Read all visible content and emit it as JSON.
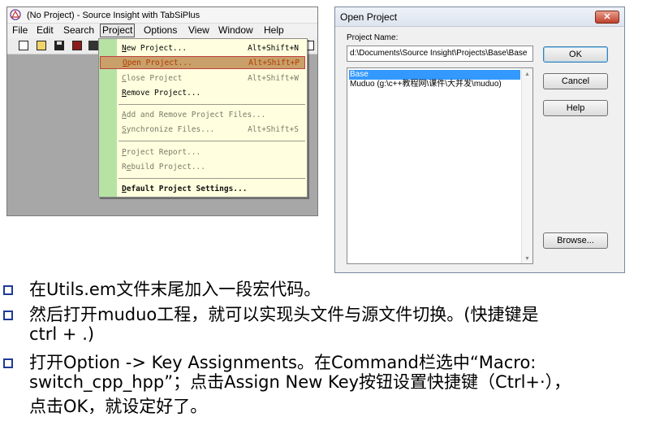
{
  "si_window": {
    "title": "(No Project) - Source Insight with TabSiPlus",
    "menu": [
      "File",
      "Edit",
      "Search",
      "Project",
      "Options",
      "View",
      "Window",
      "Help"
    ],
    "active_menu": "Project",
    "project_menu": {
      "new_hotkey": "N",
      "new_rest": "ew Project...",
      "new_shortcut": "Alt+Shift+N",
      "open_hotkey": "O",
      "open_rest": "pen Project...",
      "open_shortcut": "Alt+Shift+P",
      "close_hotkey": "C",
      "close_rest": "lose Project",
      "close_shortcut": "Alt+Shift+W",
      "remove_hotkey": "R",
      "remove_rest": "emove Project...",
      "add_hotkey": "A",
      "add_rest": "dd and Remove Project Files...",
      "sync_hotkey": "S",
      "sync_rest": "ynchronize Files...",
      "sync_shortcut": "Alt+Shift+S",
      "report_hotkey": "P",
      "report_rest": "roject Report...",
      "rebuild_a": "R",
      "rebuild_hotkey": "e",
      "rebuild_rest": "build Project...",
      "default_hotkey": "D",
      "default_rest": "efault Project Settings..."
    }
  },
  "dialog": {
    "title": "Open Project",
    "close_glyph": "✕",
    "name_label": "Project Name:",
    "name_value": "d:\\Documents\\Source Insight\\Projects\\Base\\Base",
    "list_items": [
      "Base",
      "Muduo (g:\\c++教程网\\课件\\大并发\\muduo)"
    ],
    "selected_index": 0,
    "buttons": {
      "ok": "OK",
      "cancel": "Cancel",
      "help": "Help",
      "browse": "Browse..."
    }
  },
  "bullets": [
    [
      "在Utils.em文件末尾加入一段宏代码。"
    ],
    [
      "然后打开muduo工程，就可以实现头文件与源文件切换。(快捷键是",
      "ctrl + .)"
    ],
    [
      "打开Option -> Key Assignments。在Command栏选中“Macro:",
      "switch_cpp_hpp”；点击Assign New Key按钮设置快捷键（Ctrl+·），",
      "点击OK，就设定好了。"
    ]
  ],
  "colors": {
    "bullet_box": "#1f3a93",
    "menu_gutter": "#b6e3a4",
    "menu_bg": "#ffffdf",
    "selection": "#3399ff"
  }
}
